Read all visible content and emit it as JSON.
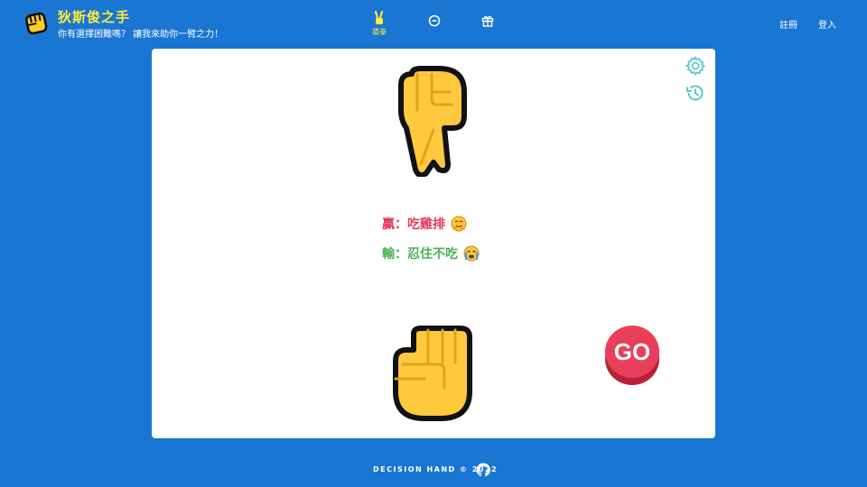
{
  "header": {
    "title": "狄斯俊之手",
    "subtitle": "你有選擇困難嗎？ 讓我來助你一臂之力！",
    "tabs": [
      {
        "icon": "victory-hand-icon",
        "label": "猜拳",
        "active": true
      },
      {
        "icon": "coin-icon",
        "label": ""
      },
      {
        "icon": "gift-icon",
        "label": ""
      }
    ],
    "register_label": "註冊",
    "login_label": "登入"
  },
  "card": {
    "settings_icon": "gear-icon",
    "history_icon": "history-icon",
    "win_label": "贏：吃雞排",
    "lose_label": "輸：忍住不吃",
    "go_label": "GO"
  },
  "footer": {
    "text": "DECISION HAND © 2022",
    "icon": "github-icon"
  },
  "colors": {
    "background": "#1976d2",
    "accent": "#ffeb3b",
    "win": "#e53956",
    "lose": "#4caf50",
    "go": "#ea3f5b",
    "tool_icons": "#4fc3c8"
  }
}
